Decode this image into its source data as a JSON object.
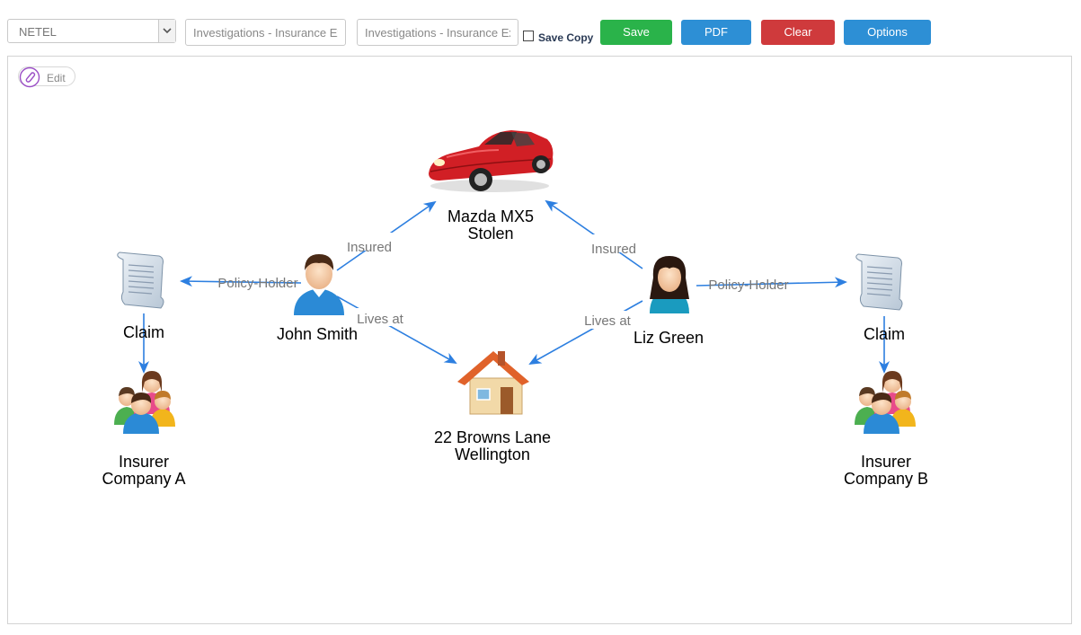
{
  "toolbar": {
    "select_value": "NETEL",
    "input1_value": "Investigations - Insurance Ex",
    "input2_value": "Investigations - Insurance Ex",
    "save_copy_label": "Save Copy",
    "save_label": "Save",
    "pdf_label": "PDF",
    "clear_label": "Clear",
    "options_label": "Options"
  },
  "canvas": {
    "edit_label": "Edit"
  },
  "graph": {
    "nodes": {
      "car": [
        "Mazda MX5",
        "Stolen"
      ],
      "john": "John Smith",
      "liz": "Liz Green",
      "claim_a": "Claim",
      "claim_b": "Claim",
      "house": [
        "22 Browns Lane",
        "Wellington"
      ],
      "insurer_a": [
        "Insurer",
        "Company A"
      ],
      "insurer_b": [
        "Insurer",
        "Company B"
      ]
    },
    "edges": {
      "john_car": "Insured",
      "liz_car": "Insured",
      "john_claim": "Policy-Holder",
      "liz_claim": "Policy-Holder",
      "john_house": "Lives at",
      "liz_house": "Lives at"
    },
    "colors": {
      "edge": "#2d7fe0",
      "car": "#d11f25",
      "house_roof": "#e0622a",
      "person_shirt": "#2b8ad6"
    }
  }
}
